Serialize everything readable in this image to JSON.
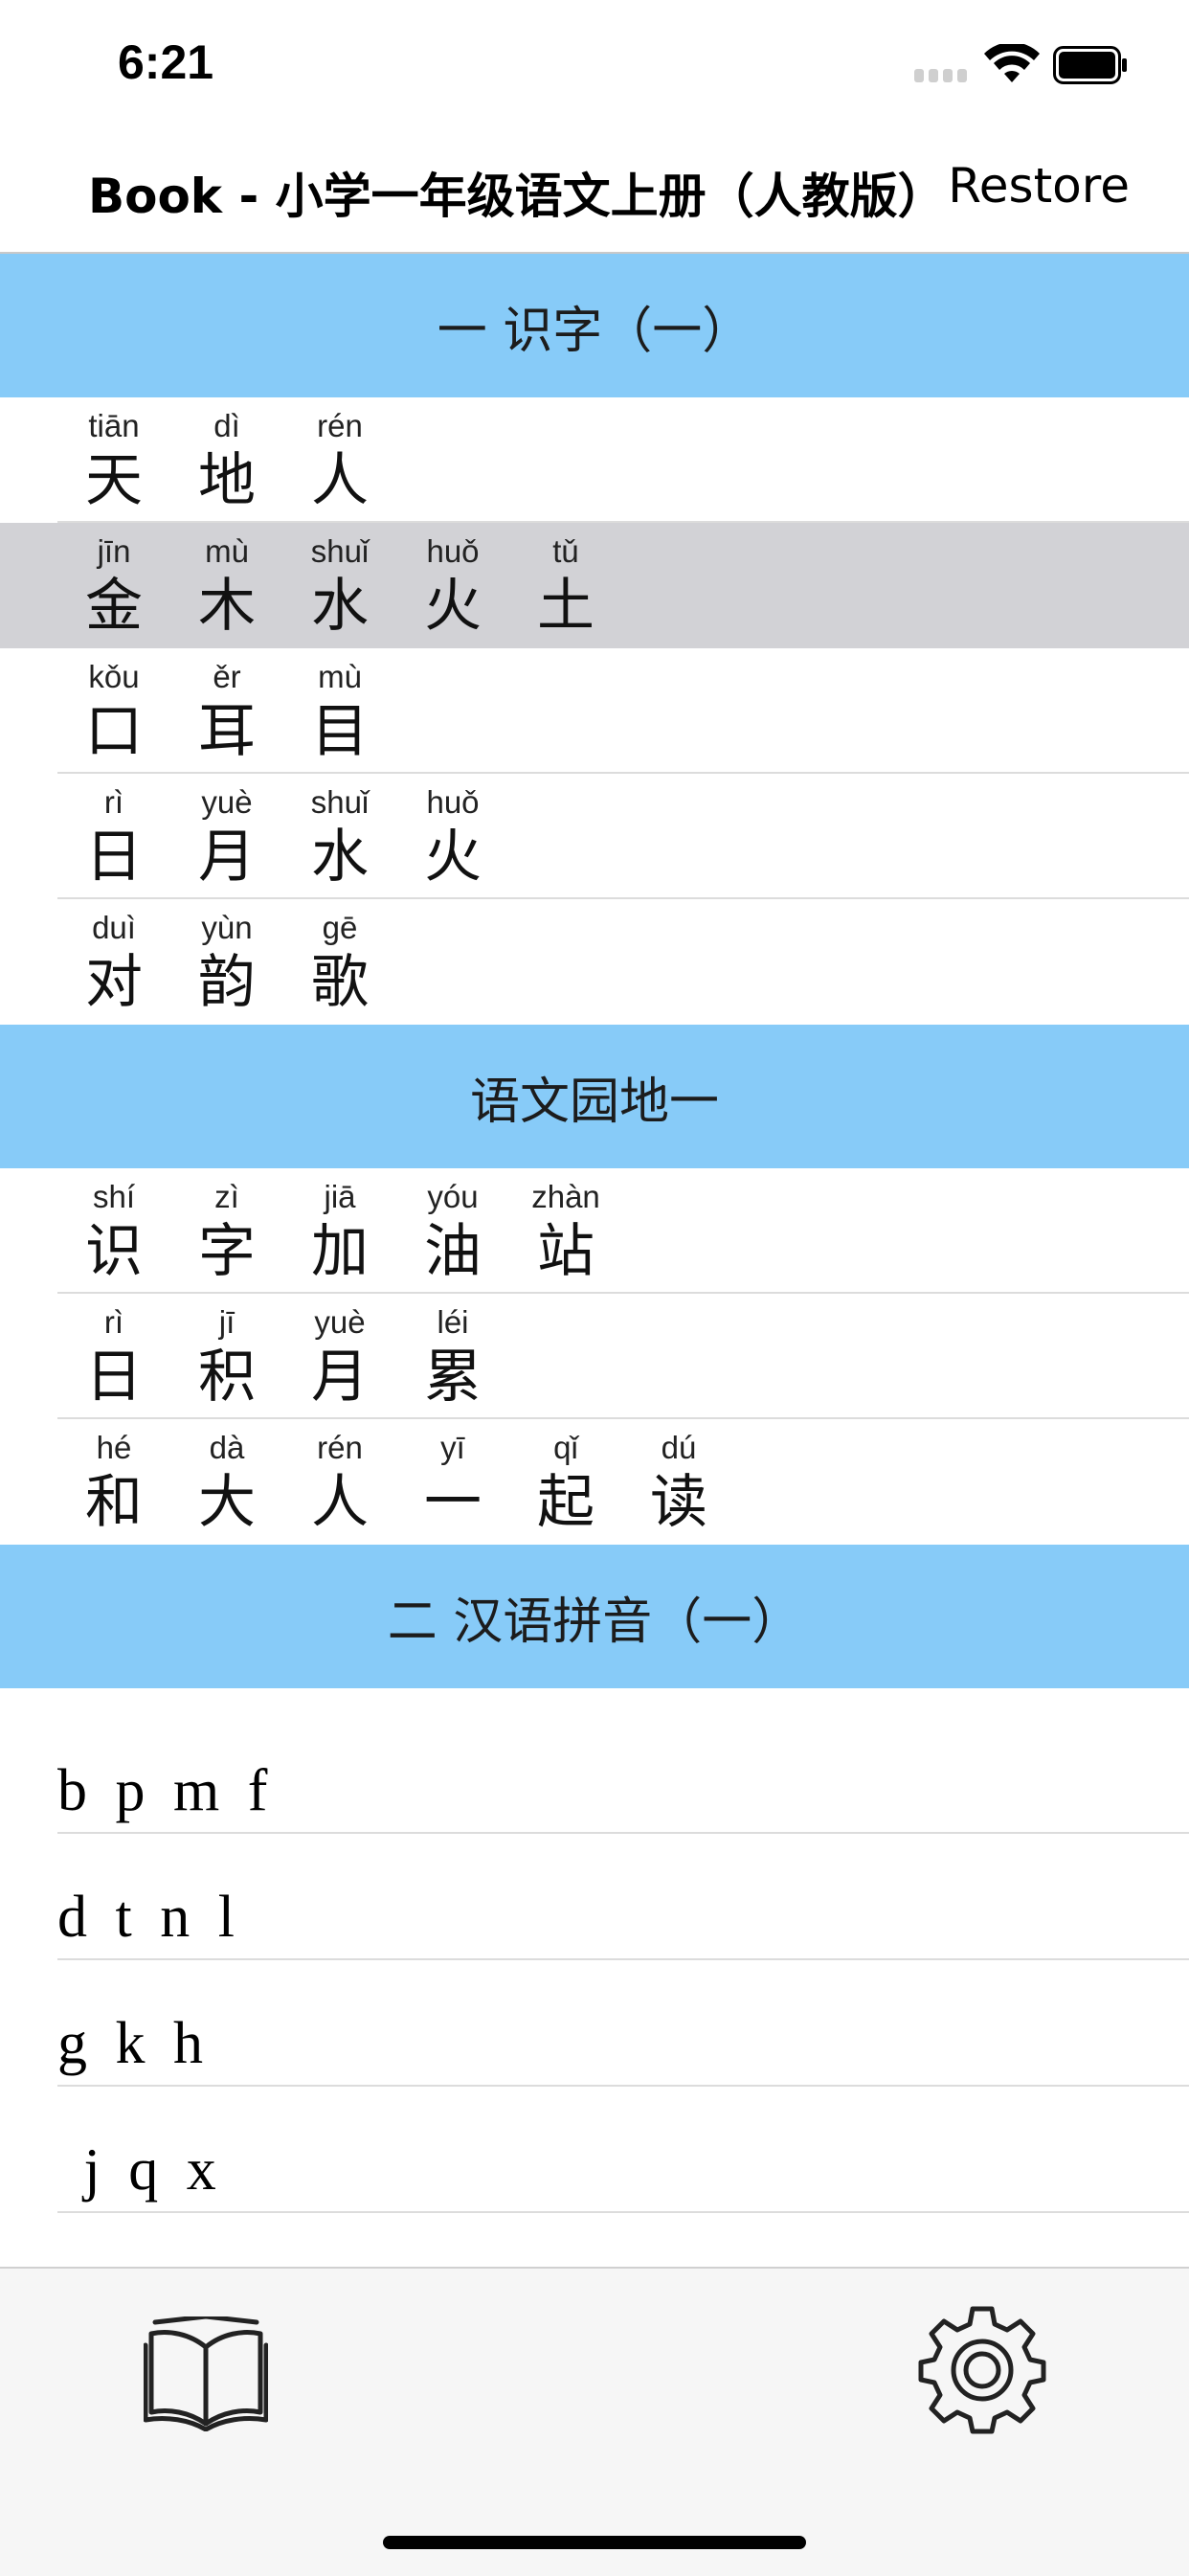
{
  "status": {
    "time": "6:21"
  },
  "nav": {
    "title": "Book - 小学一年级语文上册（人教版）",
    "restore_label": "Restore"
  },
  "sections": [
    {
      "title": "一 识字（一）"
    },
    {
      "title": "语文园地一"
    },
    {
      "title": "二 汉语拼音（一）"
    }
  ],
  "rows": [
    [
      {
        "py": "tiān",
        "hz": "天"
      },
      {
        "py": "dì",
        "hz": "地"
      },
      {
        "py": "rén",
        "hz": "人"
      }
    ],
    [
      {
        "py": "jīn",
        "hz": "金"
      },
      {
        "py": "mù",
        "hz": "木"
      },
      {
        "py": "shuǐ",
        "hz": "水"
      },
      {
        "py": "huǒ",
        "hz": "火"
      },
      {
        "py": "tǔ",
        "hz": "土"
      }
    ],
    [
      {
        "py": "kǒu",
        "hz": "口"
      },
      {
        "py": "ěr",
        "hz": "耳"
      },
      {
        "py": "mù",
        "hz": "目"
      }
    ],
    [
      {
        "py": "rì",
        "hz": "日"
      },
      {
        "py": "yuè",
        "hz": "月"
      },
      {
        "py": "shuǐ",
        "hz": "水"
      },
      {
        "py": "huǒ",
        "hz": "火"
      }
    ],
    [
      {
        "py": "duì",
        "hz": "对"
      },
      {
        "py": "yùn",
        "hz": "韵"
      },
      {
        "py": "gē",
        "hz": "歌"
      }
    ],
    [
      {
        "py": "shí",
        "hz": "识"
      },
      {
        "py": "zì",
        "hz": "字"
      },
      {
        "py": "jiā",
        "hz": "加"
      },
      {
        "py": "yóu",
        "hz": "油"
      },
      {
        "py": "zhàn",
        "hz": "站"
      }
    ],
    [
      {
        "py": "rì",
        "hz": "日"
      },
      {
        "py": "jī",
        "hz": "积"
      },
      {
        "py": "yuè",
        "hz": "月"
      },
      {
        "py": "léi",
        "hz": "累"
      }
    ],
    [
      {
        "py": "hé",
        "hz": "和"
      },
      {
        "py": "dà",
        "hz": "大"
      },
      {
        "py": "rén",
        "hz": "人"
      },
      {
        "py": "yī",
        "hz": "一"
      },
      {
        "py": "qǐ",
        "hz": "起"
      },
      {
        "py": "dú",
        "hz": "读"
      }
    ]
  ],
  "pinyin_lines": [
    "b p m f",
    "d t n l",
    "g k h",
    " j q x"
  ],
  "tabs": {
    "book_icon": "book-icon",
    "settings_icon": "gear-icon"
  },
  "colors": {
    "section_header": "#87cbf8",
    "selected_row": "#d2d2d6"
  }
}
